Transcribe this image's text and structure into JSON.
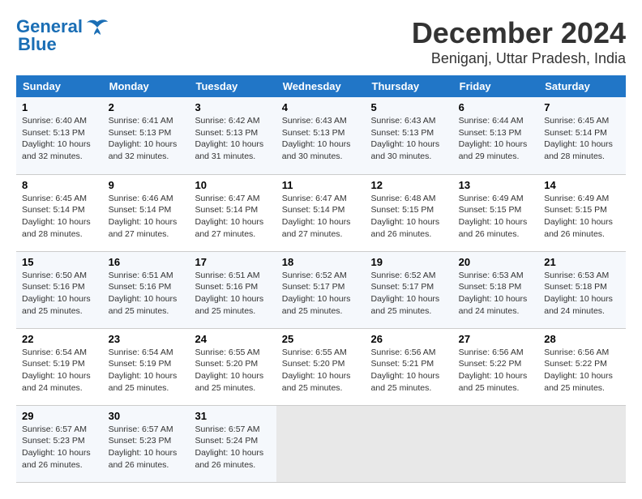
{
  "logo": {
    "text_general": "General",
    "text_blue": "Blue"
  },
  "title": "December 2024",
  "location": "Beniganj, Uttar Pradesh, India",
  "days_of_week": [
    "Sunday",
    "Monday",
    "Tuesday",
    "Wednesday",
    "Thursday",
    "Friday",
    "Saturday"
  ],
  "weeks": [
    [
      {
        "day": "1",
        "sunrise": "6:40 AM",
        "sunset": "5:13 PM",
        "daylight": "10 hours and 32 minutes."
      },
      {
        "day": "2",
        "sunrise": "6:41 AM",
        "sunset": "5:13 PM",
        "daylight": "10 hours and 32 minutes."
      },
      {
        "day": "3",
        "sunrise": "6:42 AM",
        "sunset": "5:13 PM",
        "daylight": "10 hours and 31 minutes."
      },
      {
        "day": "4",
        "sunrise": "6:43 AM",
        "sunset": "5:13 PM",
        "daylight": "10 hours and 30 minutes."
      },
      {
        "day": "5",
        "sunrise": "6:43 AM",
        "sunset": "5:13 PM",
        "daylight": "10 hours and 30 minutes."
      },
      {
        "day": "6",
        "sunrise": "6:44 AM",
        "sunset": "5:13 PM",
        "daylight": "10 hours and 29 minutes."
      },
      {
        "day": "7",
        "sunrise": "6:45 AM",
        "sunset": "5:14 PM",
        "daylight": "10 hours and 28 minutes."
      }
    ],
    [
      {
        "day": "8",
        "sunrise": "6:45 AM",
        "sunset": "5:14 PM",
        "daylight": "10 hours and 28 minutes."
      },
      {
        "day": "9",
        "sunrise": "6:46 AM",
        "sunset": "5:14 PM",
        "daylight": "10 hours and 27 minutes."
      },
      {
        "day": "10",
        "sunrise": "6:47 AM",
        "sunset": "5:14 PM",
        "daylight": "10 hours and 27 minutes."
      },
      {
        "day": "11",
        "sunrise": "6:47 AM",
        "sunset": "5:14 PM",
        "daylight": "10 hours and 27 minutes."
      },
      {
        "day": "12",
        "sunrise": "6:48 AM",
        "sunset": "5:15 PM",
        "daylight": "10 hours and 26 minutes."
      },
      {
        "day": "13",
        "sunrise": "6:49 AM",
        "sunset": "5:15 PM",
        "daylight": "10 hours and 26 minutes."
      },
      {
        "day": "14",
        "sunrise": "6:49 AM",
        "sunset": "5:15 PM",
        "daylight": "10 hours and 26 minutes."
      }
    ],
    [
      {
        "day": "15",
        "sunrise": "6:50 AM",
        "sunset": "5:16 PM",
        "daylight": "10 hours and 25 minutes."
      },
      {
        "day": "16",
        "sunrise": "6:51 AM",
        "sunset": "5:16 PM",
        "daylight": "10 hours and 25 minutes."
      },
      {
        "day": "17",
        "sunrise": "6:51 AM",
        "sunset": "5:16 PM",
        "daylight": "10 hours and 25 minutes."
      },
      {
        "day": "18",
        "sunrise": "6:52 AM",
        "sunset": "5:17 PM",
        "daylight": "10 hours and 25 minutes."
      },
      {
        "day": "19",
        "sunrise": "6:52 AM",
        "sunset": "5:17 PM",
        "daylight": "10 hours and 25 minutes."
      },
      {
        "day": "20",
        "sunrise": "6:53 AM",
        "sunset": "5:18 PM",
        "daylight": "10 hours and 24 minutes."
      },
      {
        "day": "21",
        "sunrise": "6:53 AM",
        "sunset": "5:18 PM",
        "daylight": "10 hours and 24 minutes."
      }
    ],
    [
      {
        "day": "22",
        "sunrise": "6:54 AM",
        "sunset": "5:19 PM",
        "daylight": "10 hours and 24 minutes."
      },
      {
        "day": "23",
        "sunrise": "6:54 AM",
        "sunset": "5:19 PM",
        "daylight": "10 hours and 25 minutes."
      },
      {
        "day": "24",
        "sunrise": "6:55 AM",
        "sunset": "5:20 PM",
        "daylight": "10 hours and 25 minutes."
      },
      {
        "day": "25",
        "sunrise": "6:55 AM",
        "sunset": "5:20 PM",
        "daylight": "10 hours and 25 minutes."
      },
      {
        "day": "26",
        "sunrise": "6:56 AM",
        "sunset": "5:21 PM",
        "daylight": "10 hours and 25 minutes."
      },
      {
        "day": "27",
        "sunrise": "6:56 AM",
        "sunset": "5:22 PM",
        "daylight": "10 hours and 25 minutes."
      },
      {
        "day": "28",
        "sunrise": "6:56 AM",
        "sunset": "5:22 PM",
        "daylight": "10 hours and 25 minutes."
      }
    ],
    [
      {
        "day": "29",
        "sunrise": "6:57 AM",
        "sunset": "5:23 PM",
        "daylight": "10 hours and 26 minutes."
      },
      {
        "day": "30",
        "sunrise": "6:57 AM",
        "sunset": "5:23 PM",
        "daylight": "10 hours and 26 minutes."
      },
      {
        "day": "31",
        "sunrise": "6:57 AM",
        "sunset": "5:24 PM",
        "daylight": "10 hours and 26 minutes."
      },
      null,
      null,
      null,
      null
    ]
  ],
  "labels": {
    "sunrise": "Sunrise:",
    "sunset": "Sunset:",
    "daylight": "Daylight:"
  }
}
